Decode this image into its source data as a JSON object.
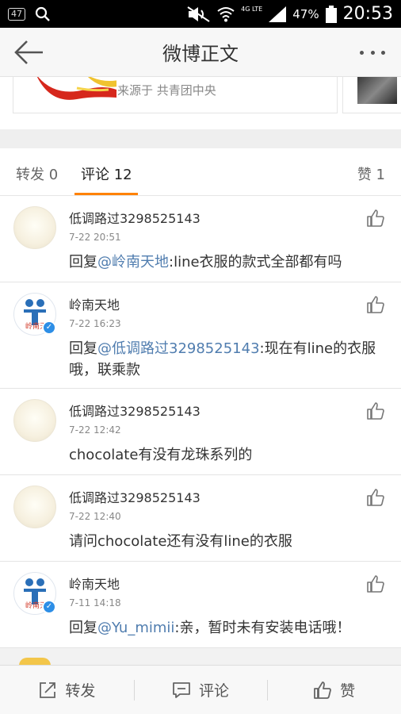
{
  "status_bar": {
    "notif_badge": "47",
    "network": "4G LTE",
    "battery": "47%",
    "time": "20:53"
  },
  "header": {
    "title": "微博正文"
  },
  "repost_card": {
    "source": "来源于 共青团中央"
  },
  "tabs": {
    "forward": "转发 0",
    "comment": "评论 12",
    "like": "赞 1"
  },
  "comments": [
    {
      "name": "低调路过3298525143",
      "time": "7-22 20:51",
      "prefix": "回复",
      "mention": "@岭南天地",
      "text": ":line衣服的款式全部都有吗",
      "avatar": "plain",
      "verified": false
    },
    {
      "name": "岭南天地",
      "time": "7-22 16:23",
      "prefix": "回复",
      "mention": "@低调路过3298525143",
      "text": ":现在有line的衣服哦，联乘款",
      "avatar": "org",
      "verified": true
    },
    {
      "name": "低调路过3298525143",
      "time": "7-22 12:42",
      "prefix": "",
      "mention": "",
      "text": "chocolate有没有龙珠系列的",
      "avatar": "plain",
      "verified": false
    },
    {
      "name": "低调路过3298525143",
      "time": "7-22 12:40",
      "prefix": "",
      "mention": "",
      "text": "请问chocolate还有没有line的衣服",
      "avatar": "plain",
      "verified": false
    },
    {
      "name": "岭南天地",
      "time": "7-11 14:18",
      "prefix": "回复",
      "mention": "@Yu_mimii",
      "text": ":亲，暂时未有安装电话哦！",
      "avatar": "org",
      "verified": true
    }
  ],
  "bottom_bar": {
    "forward": "转发",
    "comment": "评论",
    "like": "赞"
  },
  "colors": {
    "accent": "#ff8200",
    "mention": "#507daf",
    "verified": "#2d8ee6"
  },
  "icons": [
    "back-arrow-icon",
    "more-dots-icon",
    "thumbs-up-icon",
    "share-icon",
    "comment-icon",
    "search-icon",
    "wifi-icon",
    "signal-icon",
    "battery-icon"
  ]
}
